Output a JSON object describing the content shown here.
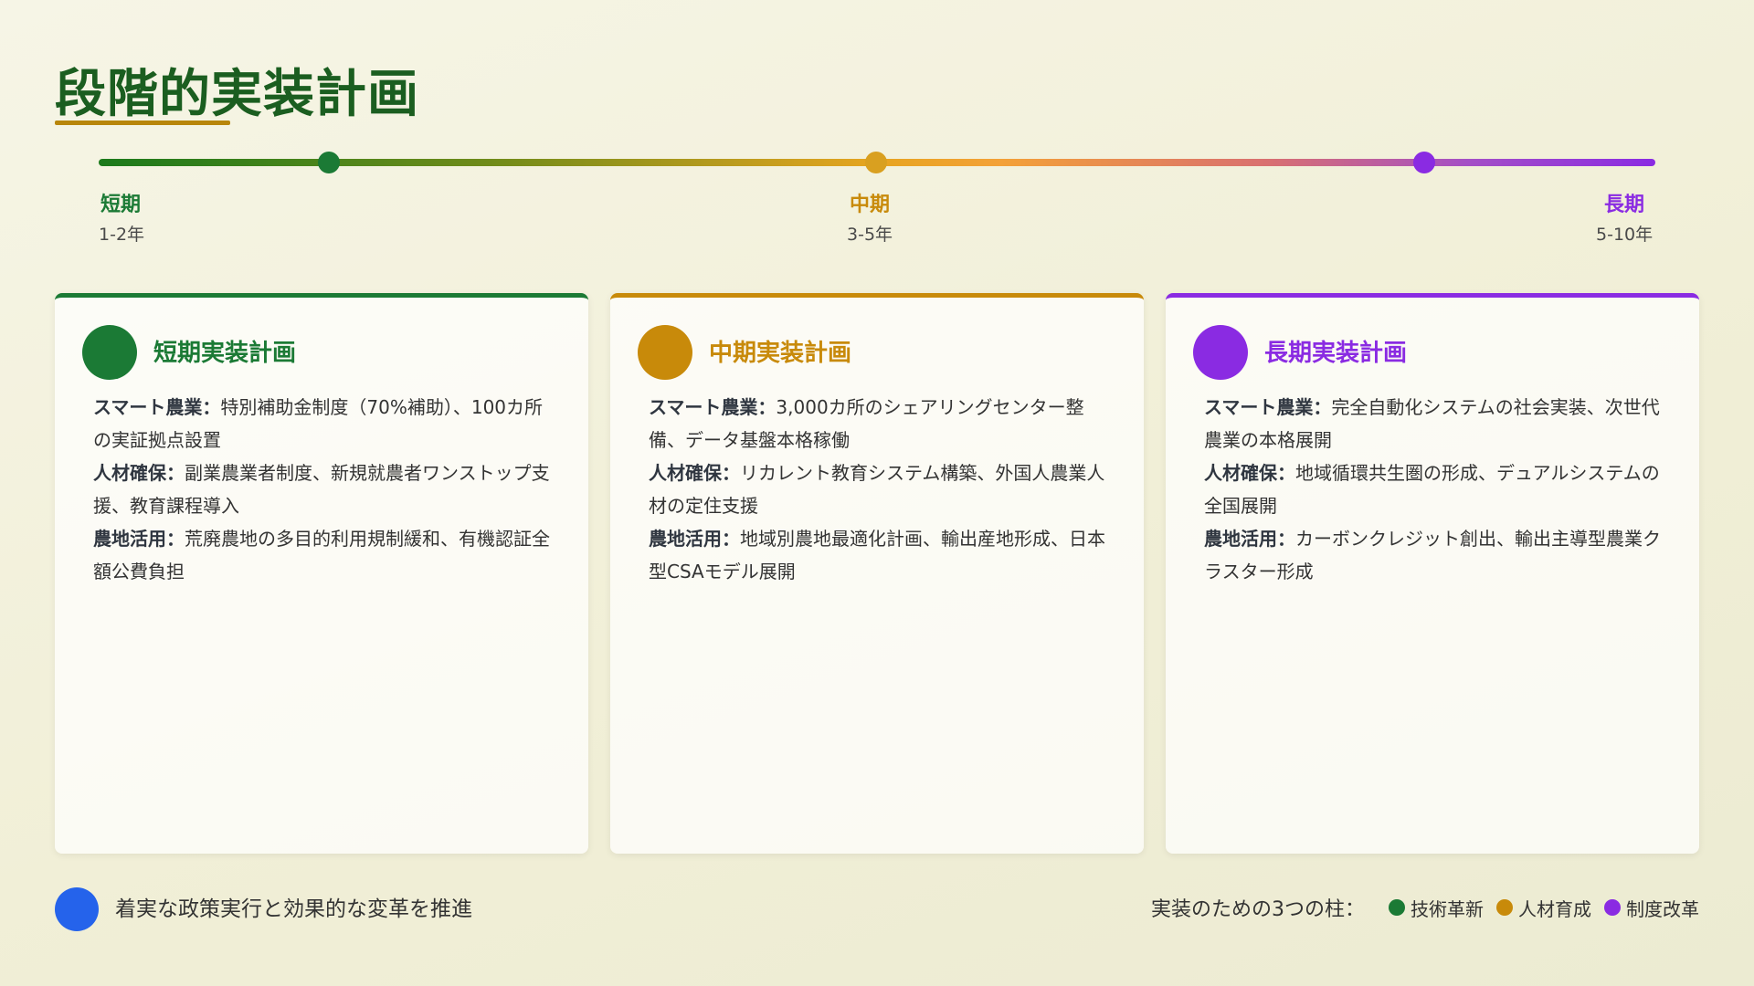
{
  "title": "段階的実装計画",
  "timeline": {
    "phases": [
      {
        "label": "短期",
        "range": "1-2年",
        "color": "#1b7a2f"
      },
      {
        "label": "中期",
        "range": "3-5年",
        "color": "#c88a0a"
      },
      {
        "label": "長期",
        "range": "5-10年",
        "color": "#8a2be2"
      }
    ]
  },
  "cards": [
    {
      "title": "短期実装計画",
      "color": "#1b7a35",
      "items": [
        {
          "head": "スマート農業：",
          "text": "特別補助金制度（70%補助）、100カ所の実証拠点設置"
        },
        {
          "head": "人材確保：",
          "text": "副業農業者制度、新規就農者ワンストップ支援、教育課程導入"
        },
        {
          "head": "農地活用：",
          "text": "荒廃農地の多目的利用規制緩和、有機認証全額公費負担"
        }
      ]
    },
    {
      "title": "中期実装計画",
      "color": "#c88a0a",
      "items": [
        {
          "head": "スマート農業：",
          "text": "3,000カ所のシェアリングセンター整備、データ基盤本格稼働"
        },
        {
          "head": "人材確保：",
          "text": "リカレント教育システム構築、外国人農業人材の定住支援"
        },
        {
          "head": "農地活用：",
          "text": "地域別農地最適化計画、輸出産地形成、日本型CSAモデル展開"
        }
      ]
    },
    {
      "title": "長期実装計画",
      "color": "#8a2be2",
      "items": [
        {
          "head": "スマート農業：",
          "text": "完全自動化システムの社会実装、次世代農業の本格展開"
        },
        {
          "head": "人材確保：",
          "text": "地域循環共生圏の形成、デュアルシステムの全国展開"
        },
        {
          "head": "農地活用：",
          "text": "カーボンクレジット創出、輸出主導型農業クラスター形成"
        }
      ]
    }
  ],
  "footer": {
    "message": "着実な政策実行と効果的な変革を推進",
    "pillars_label": "実装のための3つの柱：",
    "pillars": [
      {
        "label": "技術革新",
        "color": "#1b7a35"
      },
      {
        "label": "人材育成",
        "color": "#c88a0a"
      },
      {
        "label": "制度改革",
        "color": "#8a2be2"
      }
    ]
  }
}
